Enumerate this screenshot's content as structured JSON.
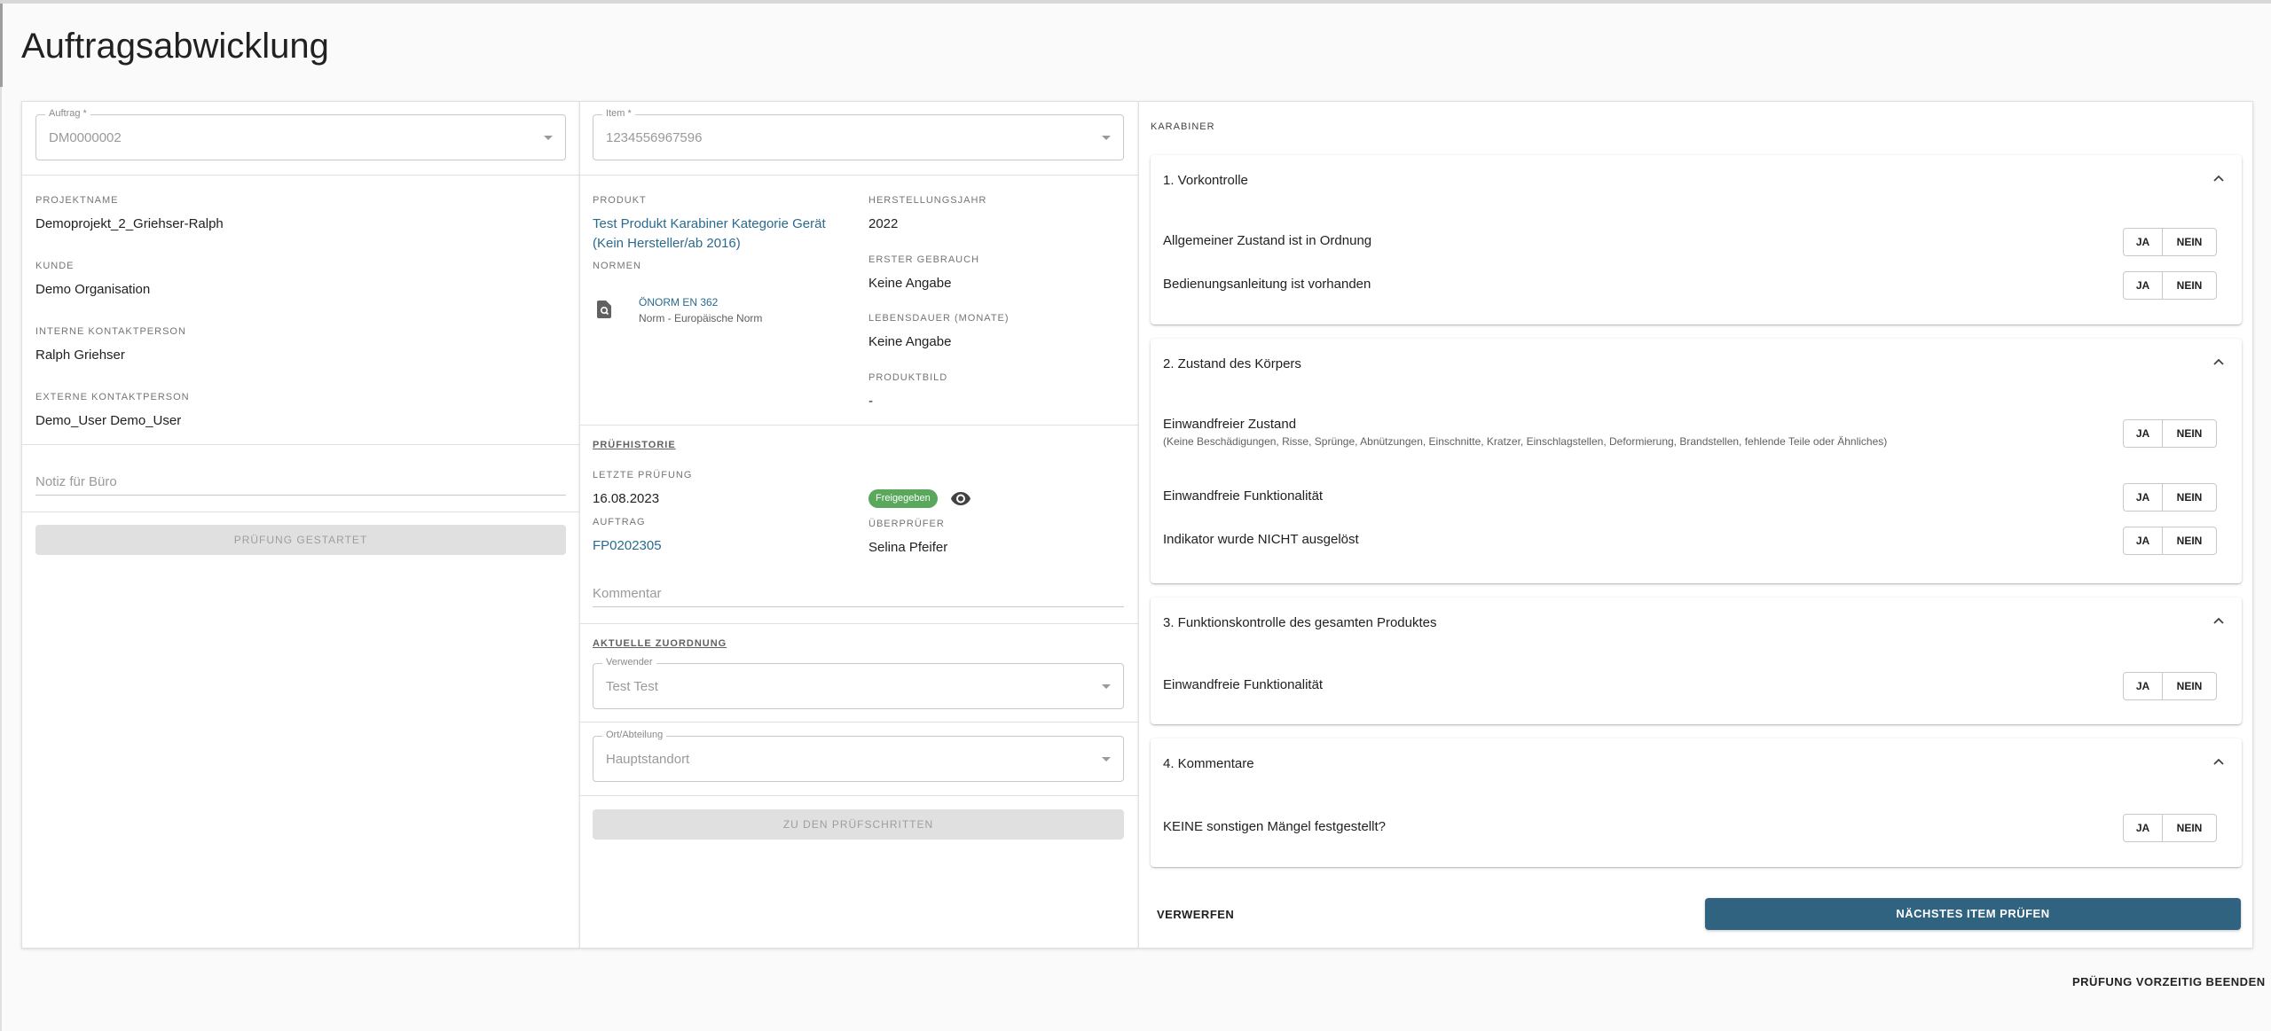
{
  "page": {
    "title": "Auftragsabwicklung"
  },
  "col1": {
    "auftrag": {
      "label": "Auftrag *",
      "value": "DM0000002"
    },
    "projektname": {
      "label": "PROJEKTNAME",
      "value": "Demoprojekt_2_Griehser-Ralph"
    },
    "kunde": {
      "label": "KUNDE",
      "value": "Demo Organisation"
    },
    "interne": {
      "label": "INTERNE KONTAKTPERSON",
      "value": "Ralph Griehser"
    },
    "externe": {
      "label": "EXTERNE KONTAKTPERSON",
      "value": "Demo_User Demo_User"
    },
    "notiz_placeholder": "Notiz für Büro",
    "pruefung_button": "PRÜFUNG GESTARTET"
  },
  "col2": {
    "item": {
      "label": "Item *",
      "value": "1234556967596"
    },
    "produkt": {
      "label": "PRODUKT",
      "line1": "Test Produkt Karabiner Kategorie Gerät",
      "line2": "(Kein Hersteller/ab 2016)"
    },
    "herstellungsjahr": {
      "label": "HERSTELLUNGSJAHR",
      "value": "2022"
    },
    "normen": {
      "label": "NORMEN",
      "name": "ÖNORM EN 362",
      "desc": "Norm - Europäische Norm"
    },
    "erster_gebrauch": {
      "label": "ERSTER GEBRAUCH",
      "value": "Keine Angabe"
    },
    "lebensdauer": {
      "label": "LEBENSDAUER (MONATE)",
      "value": "Keine Angabe"
    },
    "produktbild": {
      "label": "PRODUKTBILD",
      "value": "-"
    },
    "pruefhistorie": {
      "title": "PRÜFHISTORIE",
      "letzte_label": "LETZTE PRÜFUNG",
      "letzte_value": "16.08.2023",
      "status": "Freigegeben",
      "auftrag_label": "AUFTRAG",
      "auftrag_value": "FP0202305",
      "pruefer_label": "ÜBERPRÜFER",
      "pruefer_value": "Selina Pfeifer",
      "kommentar_placeholder": "Kommentar"
    },
    "zuordnung": {
      "title": "AKTUELLE ZUORDNUNG",
      "verwender_label": "Verwender",
      "verwender_value": "Test Test",
      "ort_label": "Ort/Abteilung",
      "ort_value": "Hauptstandort",
      "button": "ZU DEN PRÜFSCHRITTEN"
    }
  },
  "col3": {
    "title": "KARABINER",
    "yes": "JA",
    "no": "NEIN",
    "panels": [
      {
        "title": "1. Vorkontrolle",
        "questions": [
          {
            "text": "Allgemeiner Zustand ist in Ordnung"
          },
          {
            "text": "Bedienungsanleitung ist vorhanden"
          }
        ]
      },
      {
        "title": "2. Zustand des Körpers",
        "questions": [
          {
            "text": "Einwandfreier Zustand",
            "sub": "(Keine Beschädigungen, Risse, Sprünge, Abnützungen, Einschnitte, Kratzer, Einschlagstellen, Deformierung, Brandstellen, fehlende Teile oder Ähnliches)"
          },
          {
            "text": "Einwandfreie Funktionalität"
          },
          {
            "text": "Indikator wurde NICHT ausgelöst"
          }
        ]
      },
      {
        "title": "3. Funktionskontrolle des gesamten Produktes",
        "questions": [
          {
            "text": "Einwandfreie Funktionalität"
          }
        ]
      },
      {
        "title": "4. Kommentare",
        "questions": [
          {
            "text": "KEINE sonstigen Mängel festgestellt?"
          }
        ]
      }
    ],
    "verwerfen": "VERWERFEN",
    "naechstes": "NÄCHSTES ITEM PRÜFEN"
  },
  "footer": {
    "end_button": "PRÜFUNG VORZEITIG BEENDEN"
  }
}
